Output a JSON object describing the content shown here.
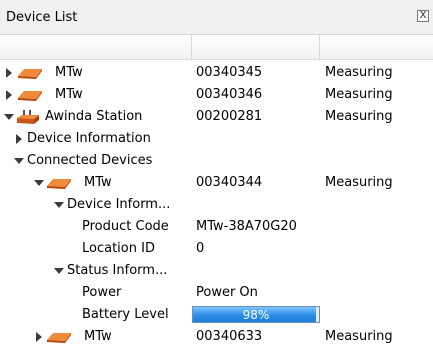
{
  "window": {
    "title": "Device List",
    "close_label": "X"
  },
  "rows": [
    {
      "name": "MTw",
      "id": "00340345",
      "status": "Measuring"
    },
    {
      "name": "MTw",
      "id": "00340346",
      "status": "Measuring"
    },
    {
      "name": "Awinda Station",
      "id": "00200281",
      "status": "Measuring"
    },
    {
      "name": "Device Information"
    },
    {
      "name": "Connected Devices"
    },
    {
      "name": "MTw",
      "id": "00340344",
      "status": "Measuring"
    },
    {
      "name": "Device Inform..."
    },
    {
      "name": "Product Code",
      "value": "MTw-38A70G20"
    },
    {
      "name": "Location ID",
      "value": "0"
    },
    {
      "name": "Status Inform..."
    },
    {
      "name": "Power",
      "value": "Power On"
    },
    {
      "name": "Battery Level",
      "value": "98%"
    },
    {
      "name": "MTw",
      "id": "00340633",
      "status": "Measuring"
    }
  ],
  "battery": {
    "percent_label": "98%",
    "fraction": 0.98
  },
  "colors": {
    "mtw_orange": "#e86a1c",
    "progress_blue": "#2a8de6"
  },
  "icons": {
    "collapsed": "chevron-right-icon",
    "expanded": "chevron-down-icon",
    "mtw": "mtw-sensor-icon",
    "station": "awinda-station-icon"
  }
}
